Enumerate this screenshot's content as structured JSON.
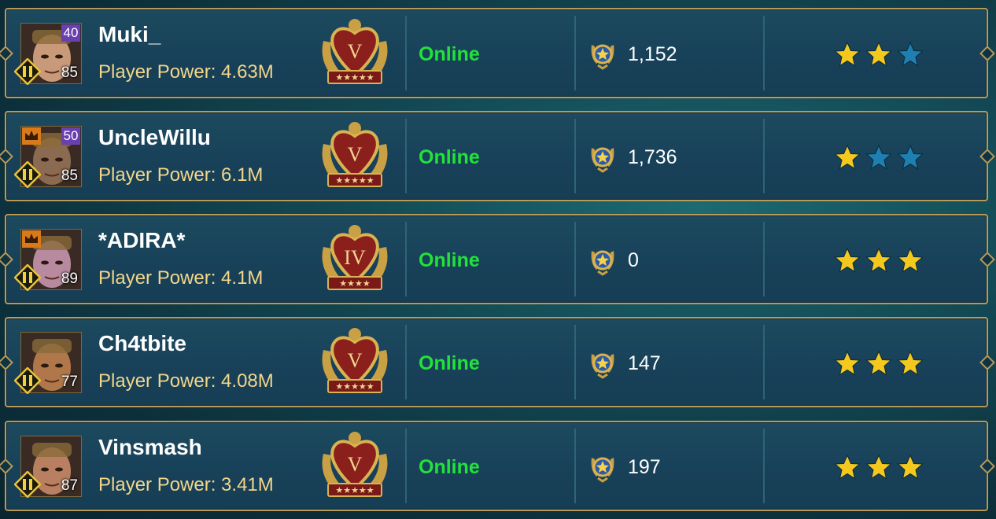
{
  "members": [
    {
      "name": "Muki_",
      "power": "Player Power: 4.63M",
      "level_top": "40",
      "level_bottom": "85",
      "has_crown": false,
      "league": "V",
      "league_stars": 5,
      "status": "Online",
      "score": "1,152",
      "stars_gold": 2,
      "stars_total": 3
    },
    {
      "name": "UncleWillu",
      "power": "Player Power: 6.1M",
      "level_top": "50",
      "level_bottom": "85",
      "has_crown": true,
      "league": "V",
      "league_stars": 5,
      "status": "Online",
      "score": "1,736",
      "stars_gold": 1,
      "stars_total": 3
    },
    {
      "name": "*ADIRA*",
      "power": "Player Power: 4.1M",
      "level_top": "",
      "level_bottom": "89",
      "has_crown": true,
      "league": "IV",
      "league_stars": 4,
      "status": "Online",
      "score": "0",
      "stars_gold": 3,
      "stars_total": 3
    },
    {
      "name": "Ch4tbite",
      "power": "Player Power: 4.08M",
      "level_top": "",
      "level_bottom": "77",
      "has_crown": false,
      "league": "V",
      "league_stars": 5,
      "status": "Online",
      "score": "147",
      "stars_gold": 3,
      "stars_total": 3
    },
    {
      "name": "Vinsmash",
      "power": "Player Power: 3.41M",
      "level_top": "",
      "level_bottom": "87",
      "has_crown": false,
      "league": "V",
      "league_stars": 5,
      "status": "Online",
      "score": "197",
      "stars_gold": 3,
      "stars_total": 3
    }
  ],
  "colors": {
    "online": "#22e23a",
    "power": "#f2d68a",
    "star_gold": "#f5c81e",
    "star_blue": "#1e7fb0",
    "frame": "#b89a5a"
  },
  "icons": {
    "league": "league-medal-icon",
    "trophy": "clan-trophy-icon",
    "star": "star-icon",
    "rank": "rank-diamond-icon",
    "crown": "crown-icon"
  }
}
